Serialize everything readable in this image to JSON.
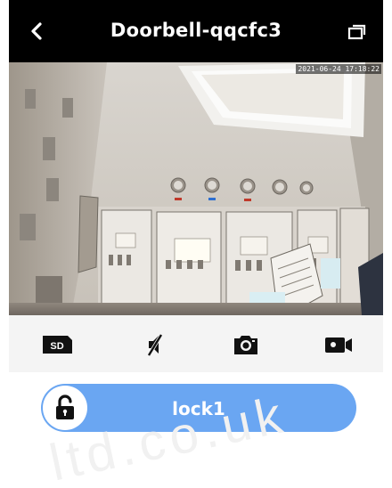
{
  "header": {
    "title": "Doorbell-qqcfc3"
  },
  "video": {
    "timestamp": "2021-06-24 17:18:22"
  },
  "controls": {
    "sd_label": "SD"
  },
  "lock": {
    "label": "lock1"
  },
  "watermark": "ltd.co.uk",
  "colors": {
    "header_bg": "#000000",
    "lock_button": "#6aa6f2",
    "controls_bg": "#f4f4f4"
  },
  "icons": [
    "back-arrow-icon",
    "fullscreen-icon",
    "sd-card-icon",
    "mute-icon",
    "camera-icon",
    "video-record-icon",
    "unlock-icon"
  ]
}
